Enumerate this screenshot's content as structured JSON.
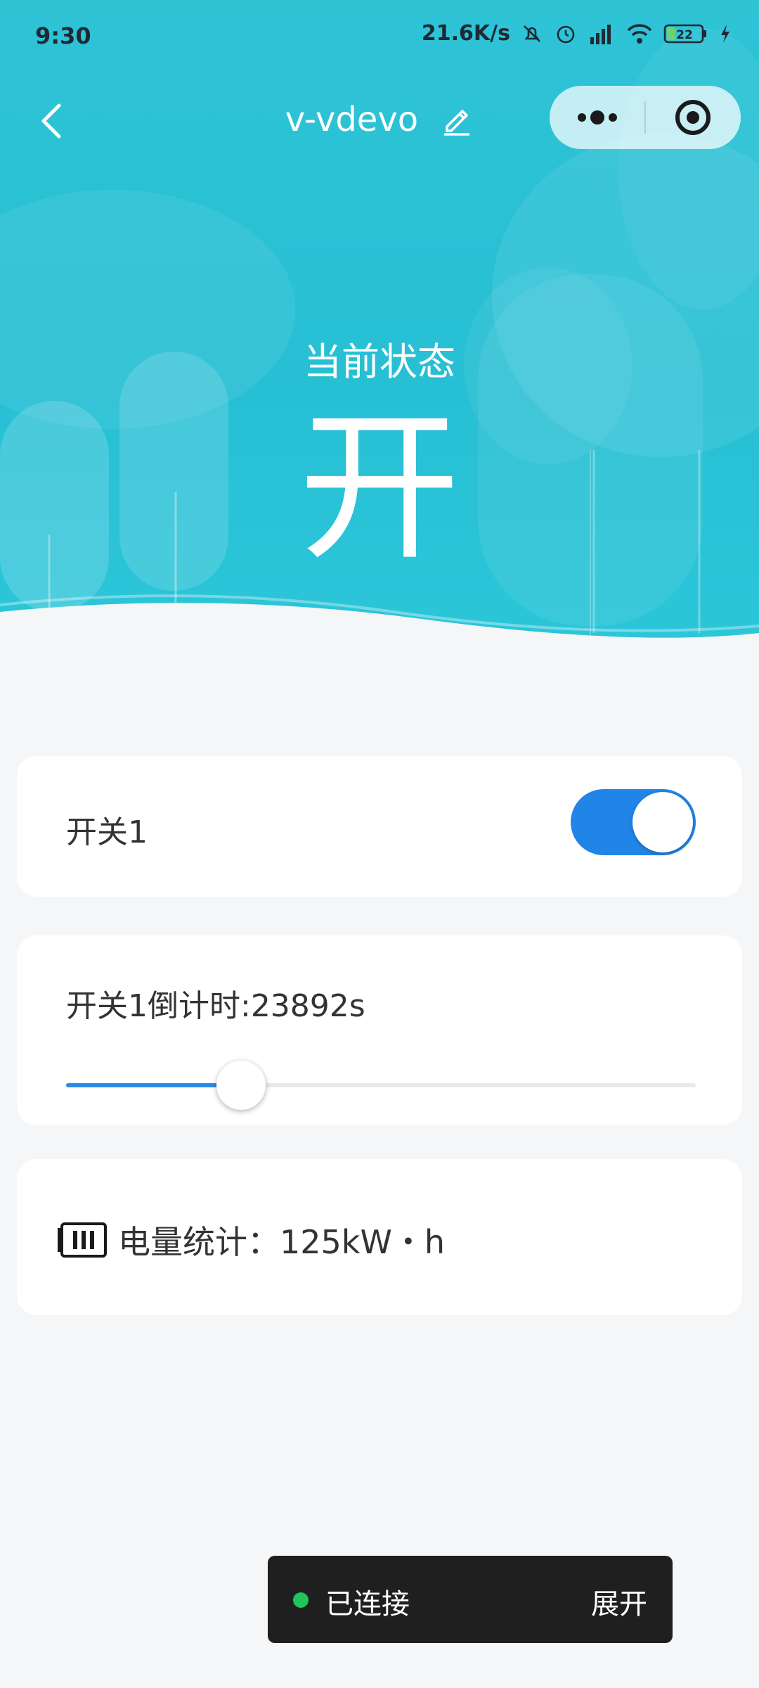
{
  "status_bar": {
    "time": "9:30",
    "network_speed": "21.6K/s",
    "battery_level": "22"
  },
  "nav": {
    "title": "v-vdevo"
  },
  "state": {
    "label": "当前状态",
    "value": "开"
  },
  "switch_card": {
    "label": "开关1",
    "on": true
  },
  "timer_card": {
    "label": "开关1倒计时:23892s",
    "slider_fraction": 0.278
  },
  "energy_card": {
    "label": "电量统计：125kW・h"
  },
  "toast": {
    "message": "已连接",
    "action": "展开"
  },
  "colors": {
    "hero": "#27bfd4",
    "accent": "#2185e8",
    "connected": "#21c35b"
  }
}
